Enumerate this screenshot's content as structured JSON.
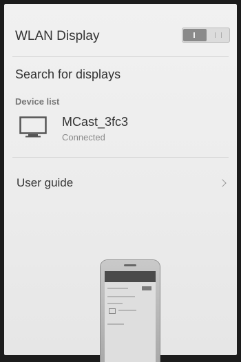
{
  "header": {
    "title": "WLAN Display",
    "toggle_state": "on"
  },
  "search": {
    "label": "Search for displays"
  },
  "device_list": {
    "label": "Device list",
    "items": [
      {
        "name": "MCast_3fc3",
        "status": "Connected",
        "icon": "monitor-icon"
      }
    ]
  },
  "user_guide": {
    "label": "User guide",
    "icon": "chevron-right-icon"
  },
  "colors": {
    "text": "#333333",
    "secondary": "#8a8a8a",
    "background": "#efefef"
  }
}
